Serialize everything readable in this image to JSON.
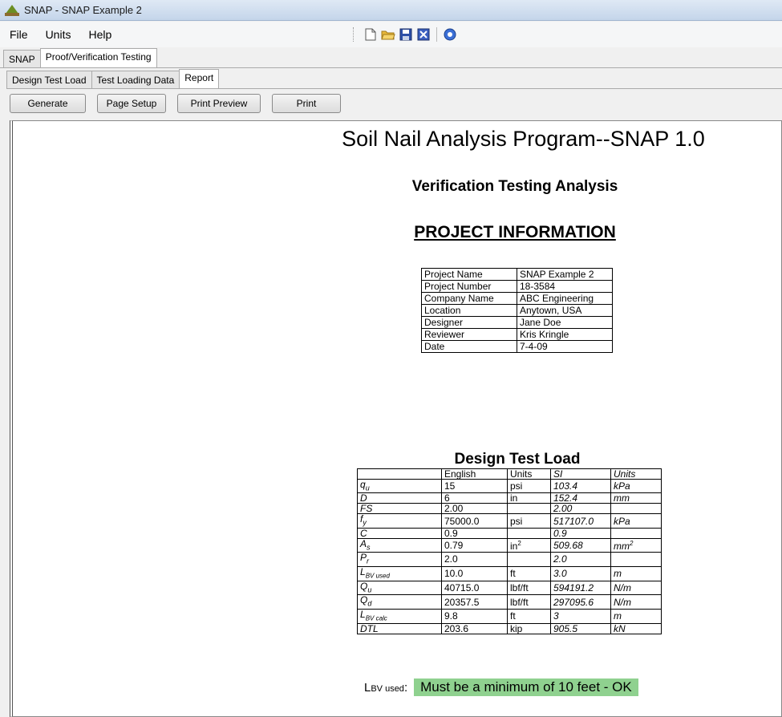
{
  "window": {
    "title": "SNAP - SNAP Example 2"
  },
  "menu": {
    "file": "File",
    "units": "Units",
    "help": "Help"
  },
  "toolbar_icons": [
    "new-file-icon",
    "open-folder-icon",
    "save-icon",
    "export-icon",
    "help-icon"
  ],
  "tabs_top": [
    {
      "label": "SNAP",
      "active": false
    },
    {
      "label": "Proof/Verification Testing",
      "active": true
    }
  ],
  "tabs_sub": [
    {
      "label": "Design Test Load",
      "active": false
    },
    {
      "label": "Test Loading Data",
      "active": false
    },
    {
      "label": "Report",
      "active": true
    }
  ],
  "buttons": {
    "generate": "Generate",
    "page_setup": "Page Setup",
    "print_preview": "Print Preview",
    "print": "Print"
  },
  "report": {
    "title": "Soil Nail Analysis Program--SNAP 1.0",
    "subtitle": "Verification Testing Analysis",
    "project_heading": "PROJECT INFORMATION",
    "project_rows": [
      [
        "Project Name",
        "SNAP Example 2"
      ],
      [
        "Project Number",
        "18-3584"
      ],
      [
        "Company Name",
        "ABC Engineering"
      ],
      [
        "Location",
        "Anytown, USA"
      ],
      [
        "Designer",
        "Jane Doe"
      ],
      [
        "Reviewer",
        "Kris Kringle"
      ],
      [
        "Date",
        "7-4-09"
      ]
    ],
    "dtl_heading": "Design Test Load",
    "dtl_header": [
      "",
      "English",
      "Units",
      "SI",
      "Units"
    ],
    "dtl_rows": [
      [
        "qu",
        "15",
        "psi",
        "103.4",
        "kPa"
      ],
      [
        "D",
        "6",
        "in",
        "152.4",
        "mm"
      ],
      [
        "FS",
        "2.00",
        "",
        "2.00",
        ""
      ],
      [
        "fy",
        "75000.0",
        "psi",
        "517107.0",
        "kPa"
      ],
      [
        "C",
        "0.9",
        "",
        "0.9",
        ""
      ],
      [
        "As",
        "0.79",
        "in²",
        "509.68",
        "mm²"
      ],
      [
        "Pr",
        "2.0",
        "",
        "2.0",
        ""
      ],
      [
        "LBV used",
        "10.0",
        "ft",
        "3.0",
        "m"
      ],
      [
        "Qu",
        "40715.0",
        "lbf/ft",
        "594191.2",
        "N/m"
      ],
      [
        "Qd",
        "20357.5",
        "lbf/ft",
        "297095.6",
        "N/m"
      ],
      [
        "LBV calc",
        "9.8",
        "ft",
        "3",
        "m"
      ],
      [
        "DTL",
        "203.6",
        "kip",
        "905.5",
        "kN"
      ]
    ],
    "status_label": "LBV used:",
    "status_message": "Must be a minimum of 10 feet - OK",
    "status_color": "#8fd18f"
  }
}
